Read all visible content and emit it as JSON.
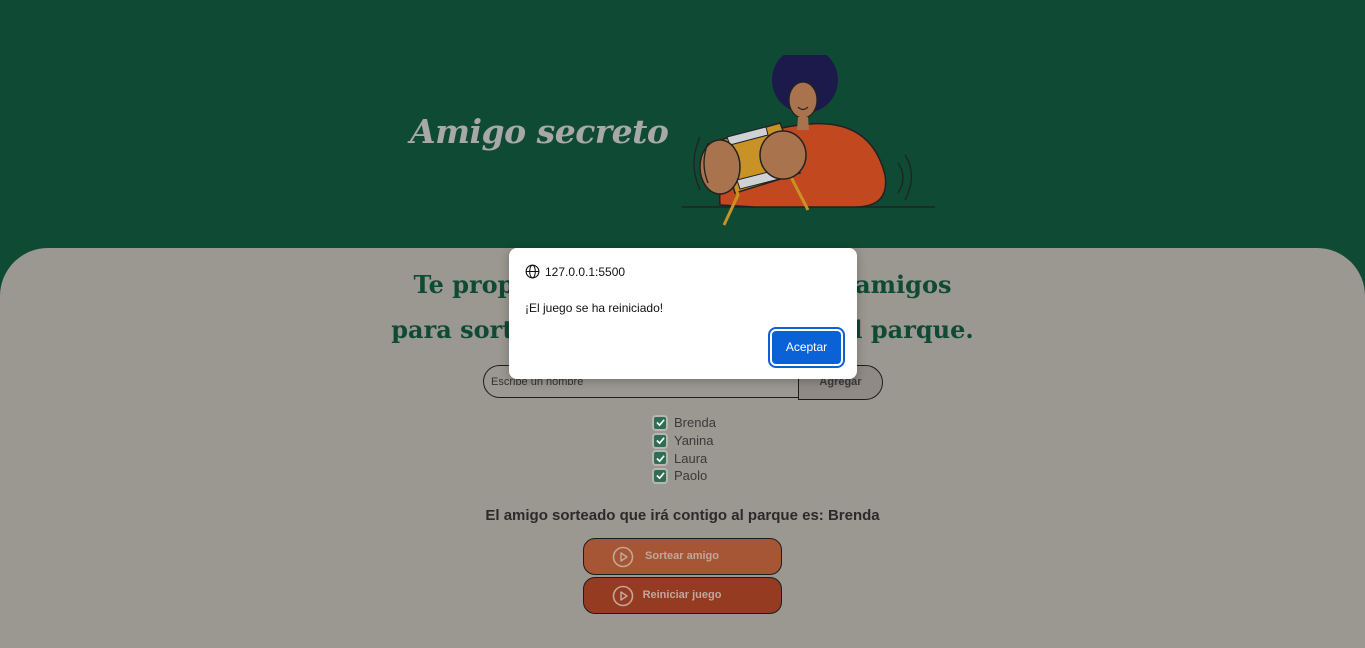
{
  "header": {
    "title": "Amigo secreto"
  },
  "main": {
    "subtitle_line1": "Te propong",
    "subtitle_line1_end": "tus amigos",
    "subtitle_line2": "para sort",
    "subtitle_line2_end": "l parque.",
    "input_placeholder": "Escribe un nombre",
    "add_label": "Agregar",
    "friends": [
      "Brenda",
      "Yanina",
      "Laura",
      "Paolo"
    ],
    "result_text": "El amigo sorteado que irá contigo al parque es: Brenda",
    "draw_label": "Sortear amigo",
    "reset_label": "Reiniciar juego"
  },
  "dialog": {
    "origin": "127.0.0.1:5500",
    "message": "¡El juego se ha reiniciado!",
    "ok_label": "Aceptar"
  },
  "colors": {
    "header_bg": "#0f4a34",
    "main_bg": "#9b9791",
    "accent_green": "#0f4a34",
    "draw_button": "#a65535",
    "reset_button": "#943b22",
    "dialog_button": "#0a62d6"
  },
  "icons": [
    "globe-icon",
    "play-icon",
    "check-icon"
  ]
}
